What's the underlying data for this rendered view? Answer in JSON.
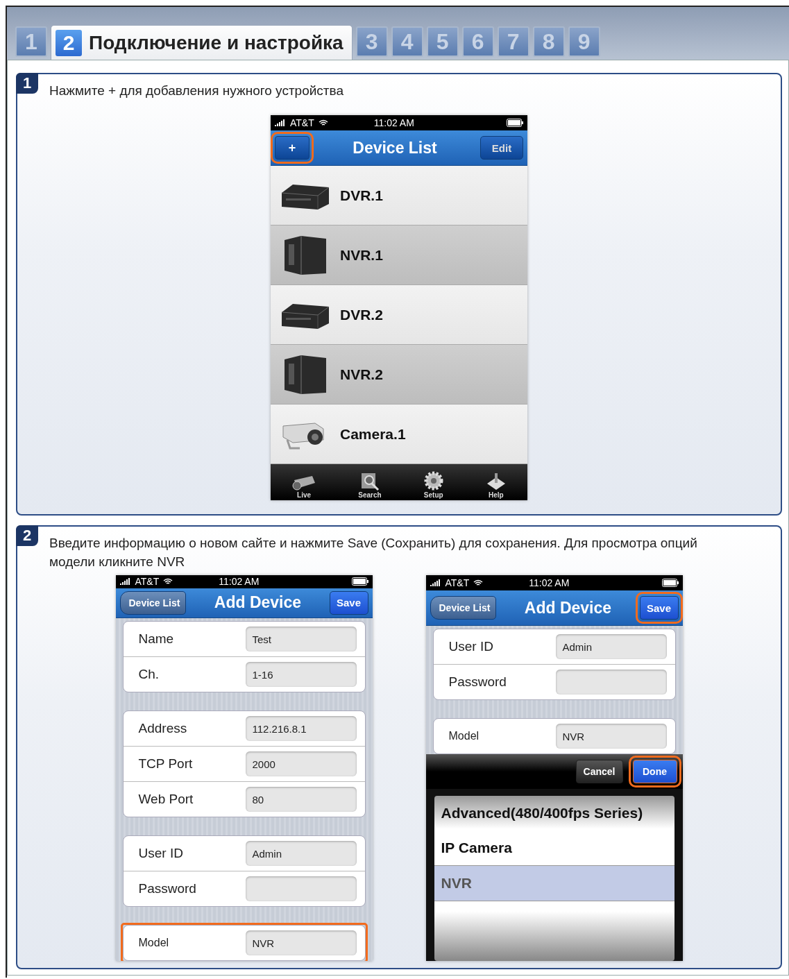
{
  "tabs": [
    {
      "number": "1",
      "selected": false
    },
    {
      "number": "2",
      "title": "Подключение и настройка",
      "selected": true
    },
    {
      "number": "3",
      "selected": false
    },
    {
      "number": "4",
      "selected": false
    },
    {
      "number": "5",
      "selected": false
    },
    {
      "number": "6",
      "selected": false
    },
    {
      "number": "7",
      "selected": false
    },
    {
      "number": "8",
      "selected": false
    },
    {
      "number": "9",
      "selected": false
    }
  ],
  "steps": [
    {
      "number": "1",
      "instruction": "Нажмите + для добавления нужного устройства",
      "phones": [
        {
          "kind": "device-list",
          "carrier": "AT&T",
          "time": "11:02 AM",
          "title": "Device List",
          "left_button": {
            "label": "+",
            "highlighted": true
          },
          "right_button": {
            "label": "Edit",
            "highlighted": false
          },
          "devices": [
            {
              "name": "DVR.1",
              "kind": "dvr",
              "shaded": false
            },
            {
              "name": "NVR.1",
              "kind": "nvr",
              "shaded": true
            },
            {
              "name": "DVR.2",
              "kind": "dvr",
              "shaded": false
            },
            {
              "name": "NVR.2",
              "kind": "nvr",
              "shaded": true
            },
            {
              "name": "Camera.1",
              "kind": "camera",
              "shaded": false
            }
          ],
          "toolbar": [
            {
              "label": "Live",
              "kind": "camera"
            },
            {
              "label": "Search",
              "kind": "search"
            },
            {
              "label": "Setup",
              "kind": "gear"
            },
            {
              "label": "Help",
              "kind": "help"
            }
          ]
        }
      ]
    },
    {
      "number": "2",
      "instruction": "Введите информацию о новом сайте и нажмите Save (Сохранить) для сохранения. Для  просмотра опций модели кликните NVR",
      "phones": [
        {
          "kind": "form",
          "carrier": "AT&T",
          "time": "11:02 AM",
          "title": "Add Device",
          "left_button": {
            "label": "Device List",
            "highlighted": false
          },
          "right_button": {
            "label": "Save",
            "highlighted": false
          },
          "groups": [
            [
              {
                "label": "Name",
                "value": "Test",
                "highlighted": false
              },
              {
                "label": "Ch.",
                "value": "1-16",
                "highlighted": false
              }
            ],
            [
              {
                "label": "Address",
                "value": "112.216.8.1",
                "highlighted": false
              },
              {
                "label": "TCP Port",
                "value": "2000",
                "highlighted": false
              },
              {
                "label": "Web Port",
                "value": "80",
                "highlighted": false
              }
            ],
            [
              {
                "label": "User ID",
                "value": "Admin",
                "highlighted": false
              },
              {
                "label": "Password",
                "highlighted": false
              }
            ],
            [
              {
                "label": "Model",
                "value": "NVR",
                "highlighted": true
              }
            ]
          ]
        },
        {
          "kind": "form",
          "carrier": "AT&T",
          "time": "11:02 AM",
          "title": "Add Device",
          "left_button": {
            "label": "Device List",
            "highlighted": false
          },
          "right_button": {
            "label": "Save",
            "highlighted": true
          },
          "groups": [
            [
              {
                "label": "User ID",
                "value": "Admin",
                "highlighted": false
              },
              {
                "label": "Password",
                "highlighted": false
              }
            ],
            [
              {
                "label": "Model",
                "value": "NVR",
                "highlighted": false
              }
            ]
          ],
          "picker": {
            "buttons": [
              {
                "label": "Cancel",
                "highlighted": false
              },
              {
                "label": "Done",
                "highlighted": true
              }
            ],
            "options": [
              {
                "label": "Advanced(480/400fps Series)",
                "selected": false
              },
              {
                "label": "IP Camera",
                "selected": false
              },
              {
                "label": "NVR",
                "selected": true
              }
            ]
          }
        }
      ]
    }
  ]
}
